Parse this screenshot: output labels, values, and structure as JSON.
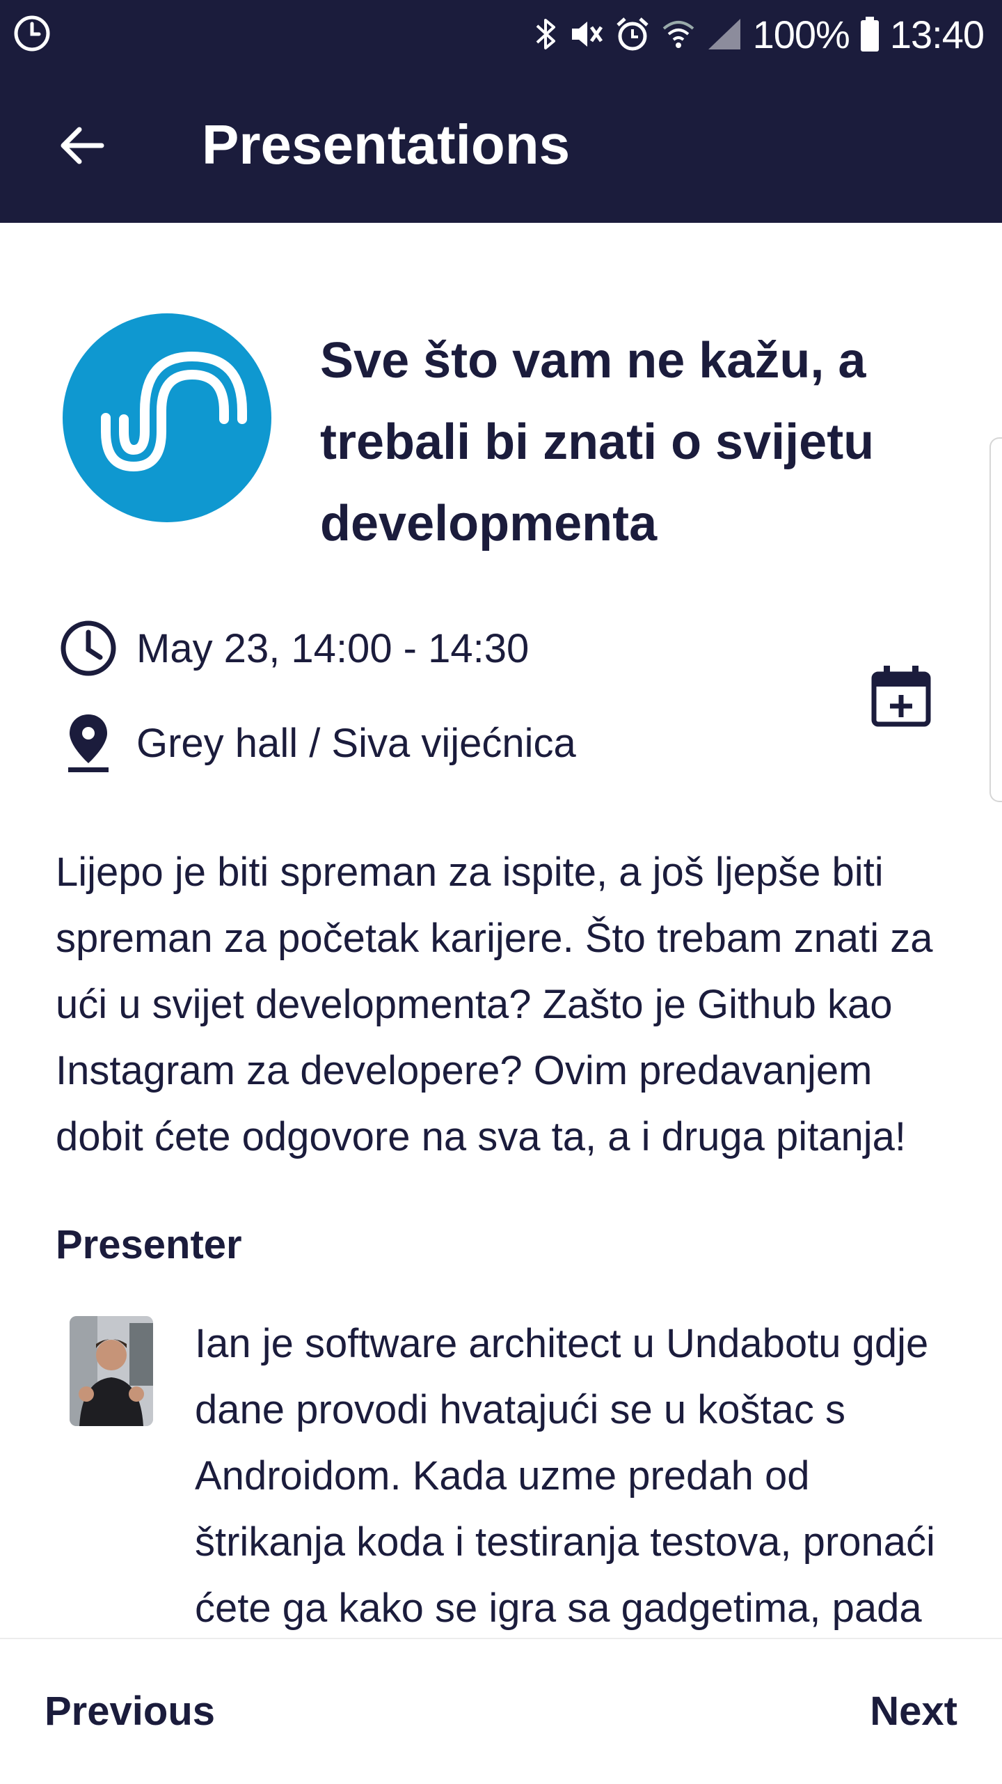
{
  "status_bar": {
    "left_icon": "clock-icon",
    "icons": [
      "bluetooth-icon",
      "vibrate-mute-icon",
      "alarm-icon",
      "wifi-icon",
      "cell-signal-icon"
    ],
    "battery_percent": "100%",
    "time": "13:40"
  },
  "app_bar": {
    "back_icon": "arrow-left-icon",
    "title": "Presentations"
  },
  "presentation": {
    "logo_icon": "un-logo-icon",
    "title": "Sve što vam ne kažu, a trebali bi znati o svijetu developmenta",
    "datetime": "May 23, 14:00 - 14:30",
    "location": "Grey hall / Siva vijećnica",
    "add_to_calendar_icon": "calendar-add-icon",
    "description": "Lijepo je biti spreman za ispite, a još ljepše biti spreman za početak karijere. Što trebam znati za ući u svijet developmenta? Zašto je Github kao Instagram za developere? Ovim predavanjem dobit ćete odgovore na sva ta, a i druga pitanja!"
  },
  "presenter": {
    "heading": "Presenter",
    "bio": "Ian je software architect u Undabotu gdje dane provodi hvatajući se u koštac s Androidom. Kada uzme predah od štrikanja koda i testiranja testova,  pronaći ćete ga kako se igra sa gadgetima, pada sa skejta"
  },
  "navigation": {
    "previous_label": "Previous",
    "next_label": "Next"
  },
  "colors": {
    "header_bg": "#1b1c3c",
    "logo_bg": "#0f98d0",
    "text": "#1b1c3c"
  }
}
